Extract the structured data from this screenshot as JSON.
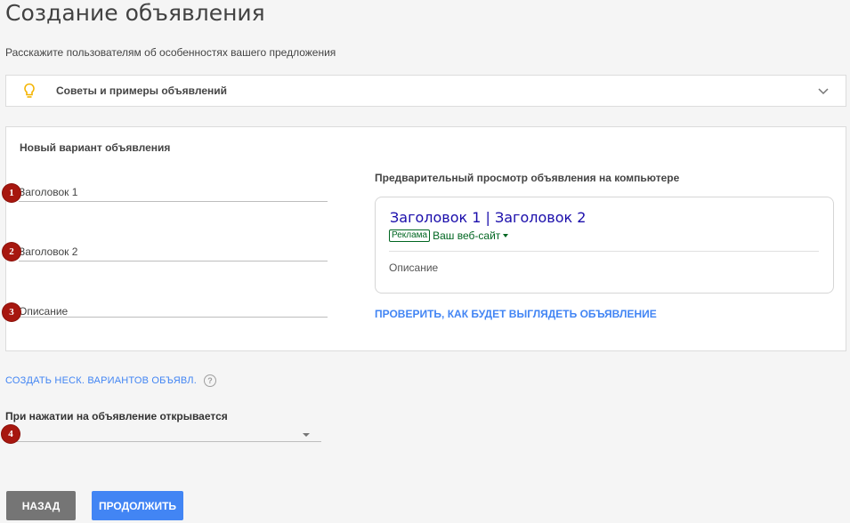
{
  "page": {
    "title": "Создание объявления",
    "subtitle": "Расскажите пользователям об особенностях вашего предложения"
  },
  "tips": {
    "label": "Советы и примеры объявлений",
    "icon": "lightbulb-icon",
    "icon_color": "#f4b400"
  },
  "form": {
    "card_title": "Новый вариант объявления",
    "fields": [
      {
        "marker": "1",
        "placeholder": "Заголовок 1"
      },
      {
        "marker": "2",
        "placeholder": "Заголовок 2"
      },
      {
        "marker": "3",
        "placeholder": "Описание"
      }
    ]
  },
  "preview": {
    "heading": "Предварительный просмотр объявления на компьютере",
    "headline": "Заголовок 1 | Заголовок 2",
    "badge": "Реклама",
    "url": "Ваш веб-сайт",
    "description": "Описание",
    "check_link": "ПРОВЕРИТЬ, КАК БУДЕТ ВЫГЛЯДЕТЬ ОБЪЯВЛЕНИЕ"
  },
  "variants": {
    "link": "СОЗДАТЬ НЕСК. ВАРИАНТОВ ОБЪЯВЛ.",
    "help_glyph": "?"
  },
  "destination": {
    "label": "При нажатии на объявление открывается",
    "marker": "4",
    "value": ""
  },
  "buttons": {
    "back": "НАЗАД",
    "next": "ПРОДОЛЖИТЬ"
  },
  "colors": {
    "marker": "#a7170f",
    "link": "#4285f4",
    "ad_headline": "#1a0dab",
    "ad_green": "#006621",
    "primary_button": "#4285f4",
    "secondary_button": "#757575"
  }
}
